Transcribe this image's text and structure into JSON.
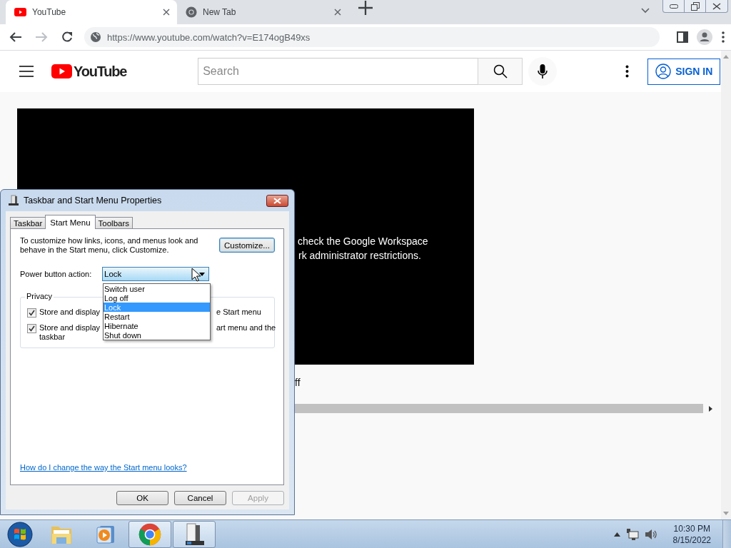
{
  "browser": {
    "tabs": [
      {
        "title": "YouTube",
        "kind": "youtube",
        "selected": true
      },
      {
        "title": "New Tab",
        "kind": "chrome",
        "selected": false
      }
    ],
    "url": "https://www.youtube.com/watch?v=E174ogB49xs"
  },
  "youtube": {
    "logo_text": "YouTube",
    "search": {
      "placeholder": "Search"
    },
    "sign_in": "SIGN IN",
    "video_message": [
      "check the Google Workspace",
      "rk administrator restrictions."
    ],
    "below_text": "ff"
  },
  "dialog": {
    "title": "Taskbar and Start Menu Properties",
    "tabs": [
      {
        "label": "Taskbar",
        "selected": false
      },
      {
        "label": "Start Menu",
        "selected": true
      },
      {
        "label": "Toolbars",
        "selected": false
      }
    ],
    "description": "To customize how links, icons, and menus look and behave in the Start menu, click Customize.",
    "customize": "Customize...",
    "power_label": "Power button action:",
    "power_value": "Lock",
    "options": [
      {
        "label": "Switch user",
        "selected": false
      },
      {
        "label": "Log off",
        "selected": false
      },
      {
        "label": "Lock",
        "selected": true
      },
      {
        "label": "Restart",
        "selected": false
      },
      {
        "label": "Hibernate",
        "selected": false
      },
      {
        "label": "Shut down",
        "selected": false
      }
    ],
    "privacy": {
      "legend": "Privacy",
      "items": [
        {
          "left": "Store and display",
          "right": "e Start menu",
          "checked": true
        },
        {
          "left": "Store and display",
          "right": "art menu and the",
          "extra": "taskbar",
          "checked": true
        }
      ]
    },
    "help_link": "How do I change the way the Start menu looks?",
    "buttons": [
      {
        "label": "OK",
        "disabled": false
      },
      {
        "label": "Cancel",
        "disabled": false
      },
      {
        "label": "Apply",
        "disabled": true
      }
    ]
  },
  "taskbar": {
    "items": [
      {
        "kind": "explorer",
        "open": false
      },
      {
        "kind": "media",
        "open": false
      },
      {
        "kind": "chrome",
        "open": true
      },
      {
        "kind": "server",
        "open": true
      }
    ],
    "clock": {
      "time": "10:30 PM",
      "date": "8/15/2022"
    }
  }
}
